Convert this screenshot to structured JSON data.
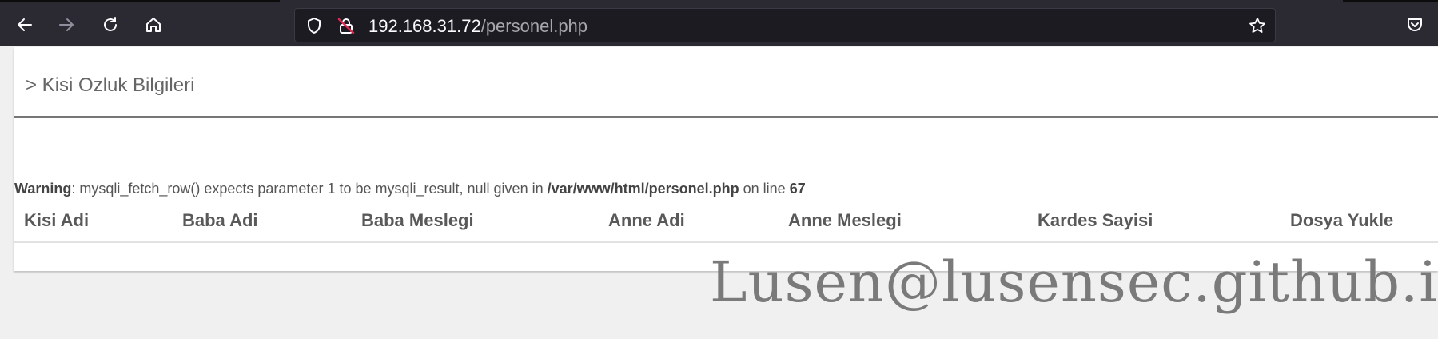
{
  "browser": {
    "url_host": "192.168.31.72",
    "url_path": "/personel.php",
    "icons": [
      "back-arrow-icon",
      "forward-arrow-icon",
      "reload-icon",
      "home-icon",
      "shield-icon",
      "insecure-lock-icon",
      "bookmark-star-icon",
      "pocket-icon"
    ]
  },
  "page": {
    "title": "> Kisi Ozluk Bilgileri",
    "warning": {
      "label": "Warning",
      "text1": ": mysqli_fetch_row() expects parameter 1 to be mysqli_result, null given in ",
      "path": "/var/www/html/personel.php",
      "text2": " on line ",
      "line": "67"
    },
    "table": {
      "headers": [
        "Kisi Adi",
        "Baba Adi",
        "Baba Meslegi",
        "Anne Adi",
        "Anne Meslegi",
        "Kardes Sayisi",
        "Dosya Yukle"
      ]
    }
  },
  "watermark": "Lusen@lusensec.github.io",
  "colors": {
    "chrome_bg": "#2b2a33",
    "urlbar_bg": "#1c1b22",
    "page_bg": "#f0f0f0",
    "insecure_red": "#e22850"
  }
}
